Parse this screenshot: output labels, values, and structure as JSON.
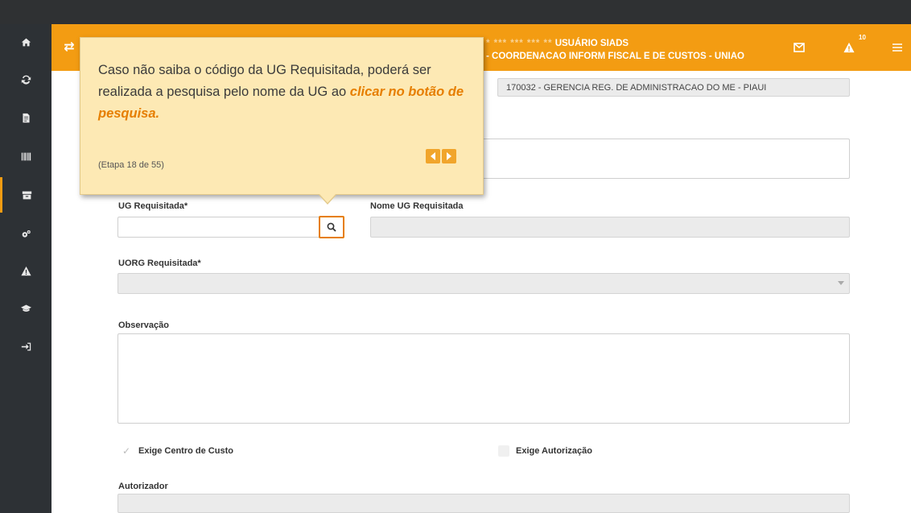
{
  "header": {
    "user_mask": "* *** *** *** **",
    "user_name": "USUÁRIO SIADS",
    "org_line": "- COORDENACAO INFORM FISCAL E DE CUSTOS - UNIAO",
    "alerts_count": "10",
    "brand_color": "#f39c12"
  },
  "sidebar": {
    "items": [
      {
        "icon": "home-icon"
      },
      {
        "icon": "refresh-icon"
      },
      {
        "icon": "document-icon"
      },
      {
        "icon": "barcode-icon"
      },
      {
        "icon": "archive-icon"
      },
      {
        "icon": "cogs-icon"
      },
      {
        "icon": "warning-icon"
      },
      {
        "icon": "graduation-icon"
      },
      {
        "icon": "logout-icon"
      }
    ]
  },
  "form": {
    "ug_requisitante_value": "170032 - GERENCIA REG. DE ADMINISTRACAO DO ME - PIAUI",
    "ug_requisitada_label": "UG Requisitada*",
    "ug_requisitada_value": "",
    "nome_ug_label": "Nome UG Requisitada",
    "nome_ug_value": "",
    "uorg_label": "UORG Requisitada*",
    "uorg_value": "",
    "observacao_label": "Observação",
    "exige_centro_label": "Exige Centro de Custo",
    "exige_autorizacao_label": "Exige Autorização",
    "autorizador_label": "Autorizador",
    "autorizador_value": ""
  },
  "tooltip": {
    "text_part1": "Caso não saiba o código da UG Requisitada, poderá ser realizada a pesquisa pelo nome da UG ao ",
    "text_highlight": "clicar no botão de pesquisa.",
    "step": "(Etapa 18 de 55)"
  }
}
